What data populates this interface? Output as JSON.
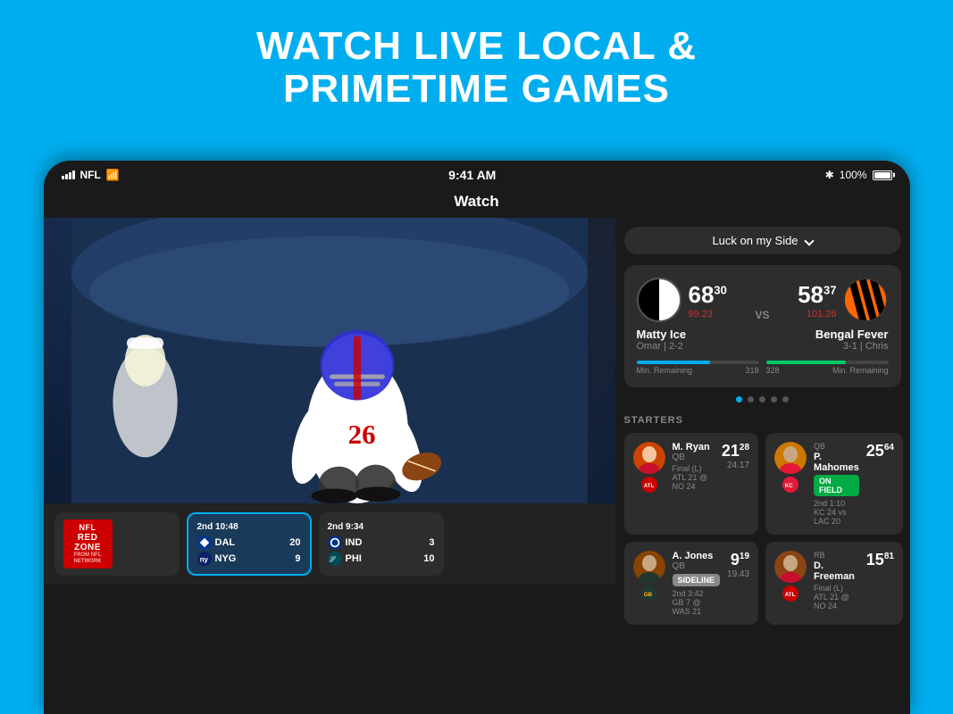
{
  "page": {
    "headline_line1": "WATCH LIVE LOCAL &",
    "headline_line2": "PRIMETIME GAMES"
  },
  "status_bar": {
    "carrier": "NFL",
    "wifi": true,
    "time": "9:41 AM",
    "bluetooth": true,
    "battery": "100%"
  },
  "nav": {
    "title": "Watch"
  },
  "playlist": {
    "label": "Luck on my Side",
    "dropdown": true
  },
  "matchup": {
    "team1": {
      "name": "Matty Ice",
      "owner": "Omar",
      "record": "2-2",
      "score": "68",
      "score_decimal": "30",
      "score_sub": "99.23",
      "min_remaining": "318"
    },
    "team2": {
      "name": "Bengal Fever",
      "owner": "Chris",
      "record": "3-1",
      "score": "58",
      "score_decimal": "37",
      "score_sub": "101.26",
      "min_remaining": "328"
    },
    "vs": "VS",
    "min_label": "Min. Remaining"
  },
  "pagination": {
    "dots": 5,
    "active": 0
  },
  "starters": {
    "title": "STARTERS",
    "players": [
      {
        "name": "M. Ryan",
        "position": "QB",
        "team": "ATL",
        "score": "21",
        "score_decimal": "28",
        "score_sub": "24.17",
        "status": "",
        "game_status": "ATL 21 @ NO 24",
        "game_result": "Final (L)"
      },
      {
        "name": "P. Mahomes",
        "position": "QB",
        "team": "KC",
        "score": "25",
        "score_decimal": "64",
        "score_sub": "",
        "status": "ON FIELD",
        "game_status": "KC 24 vs LAC 20",
        "game_quarter": "2nd 1:10"
      },
      {
        "name": "A. Jones",
        "position": "QB",
        "team": "GB",
        "score": "9",
        "score_decimal": "19",
        "score_sub": "19.43",
        "status": "SIDELINE",
        "game_status": "GB 7 @ WAS 21",
        "game_quarter": "2nd 3:42"
      },
      {
        "name": "D. Freeman",
        "position": "RB",
        "team": "ATL",
        "score": "15",
        "score_decimal": "81",
        "score_sub": "",
        "status": "",
        "game_status": "ATL 21 @ NO 24",
        "game_result": "Final (L)"
      }
    ]
  },
  "game_thumbnails": [
    {
      "type": "redzone",
      "label": "NFL",
      "sublabel": "RED ZONE",
      "from": "FROM NFL NETWORK"
    },
    {
      "quarter": "2nd 10:48",
      "active": true,
      "teams": [
        {
          "abbr": "DAL",
          "score": "20",
          "logo": "dal"
        },
        {
          "abbr": "NYG",
          "score": "9",
          "logo": "nyg"
        }
      ]
    },
    {
      "quarter": "2nd 9:34",
      "active": false,
      "teams": [
        {
          "abbr": "IND",
          "score": "3",
          "logo": "ind"
        },
        {
          "abbr": "PHI",
          "score": "10",
          "logo": "phi"
        }
      ]
    }
  ]
}
